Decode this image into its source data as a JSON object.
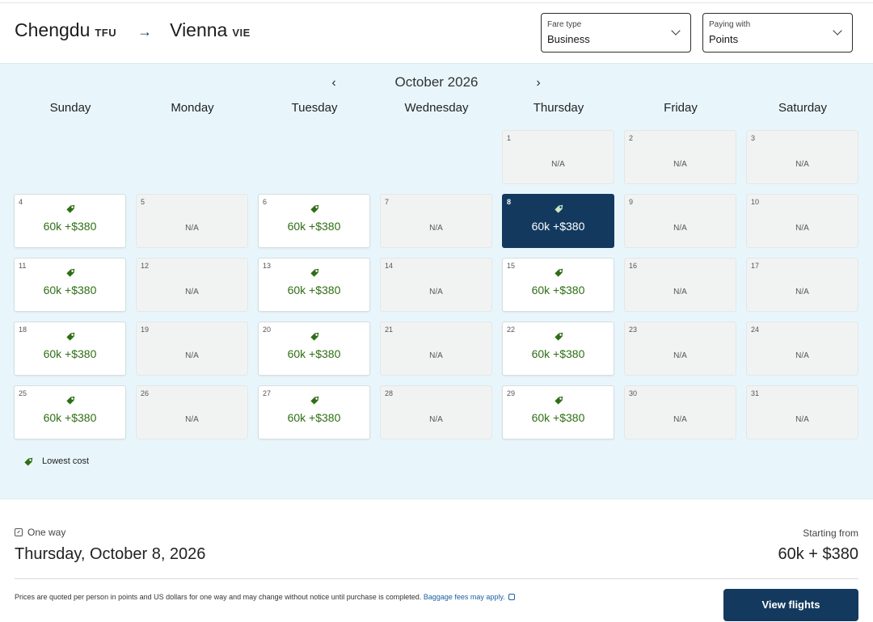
{
  "route": {
    "origin_city": "Chengdu",
    "origin_code": "TFU",
    "arrow": "→",
    "dest_city": "Vienna",
    "dest_code": "VIE"
  },
  "fare_type": {
    "label": "Fare type",
    "value": "Business"
  },
  "paying_with": {
    "label": "Paying with",
    "value": "Points"
  },
  "calendar": {
    "month_title": "October 2026",
    "prev": "‹",
    "next": "›",
    "weekdays": [
      "Sunday",
      "Monday",
      "Tuesday",
      "Wednesday",
      "Thursday",
      "Friday",
      "Saturday"
    ],
    "first_weekday_index": 4,
    "na_text": "N/A",
    "days": [
      {
        "num": "1",
        "price": null
      },
      {
        "num": "2",
        "price": null
      },
      {
        "num": "3",
        "price": null
      },
      {
        "num": "4",
        "price": "60k +$380"
      },
      {
        "num": "5",
        "price": null
      },
      {
        "num": "6",
        "price": "60k +$380"
      },
      {
        "num": "7",
        "price": null
      },
      {
        "num": "8",
        "price": "60k +$380",
        "selected": true
      },
      {
        "num": "9",
        "price": null
      },
      {
        "num": "10",
        "price": null
      },
      {
        "num": "11",
        "price": "60k +$380"
      },
      {
        "num": "12",
        "price": null
      },
      {
        "num": "13",
        "price": "60k +$380"
      },
      {
        "num": "14",
        "price": null
      },
      {
        "num": "15",
        "price": "60k +$380"
      },
      {
        "num": "16",
        "price": null
      },
      {
        "num": "17",
        "price": null
      },
      {
        "num": "18",
        "price": "60k +$380"
      },
      {
        "num": "19",
        "price": null
      },
      {
        "num": "20",
        "price": "60k +$380"
      },
      {
        "num": "21",
        "price": null
      },
      {
        "num": "22",
        "price": "60k +$380"
      },
      {
        "num": "23",
        "price": null
      },
      {
        "num": "24",
        "price": null
      },
      {
        "num": "25",
        "price": "60k +$380"
      },
      {
        "num": "26",
        "price": null
      },
      {
        "num": "27",
        "price": "60k +$380"
      },
      {
        "num": "28",
        "price": null
      },
      {
        "num": "29",
        "price": "60k +$380"
      },
      {
        "num": "30",
        "price": null
      },
      {
        "num": "31",
        "price": null
      }
    ],
    "legend": "Lowest cost"
  },
  "summary": {
    "trip_type": "One way",
    "date": "Thursday, October 8, 2026",
    "starting_label": "Starting from",
    "starting_value": "60k + $380"
  },
  "disclaimer": {
    "text": "Prices are quoted per person in points and US dollars for one way and may change without notice until purchase is completed.",
    "link": "Baggage fees may apply."
  },
  "view_button": "View flights",
  "colors": {
    "brand_navy": "#133a5e",
    "calendar_bg": "#e8f6fc",
    "price_green": "#2f6e14",
    "na_bg": "#f1f3f3"
  },
  "icons": {
    "lowest_cost": "price-tag-icon",
    "arrow": "arrow-right-icon"
  }
}
